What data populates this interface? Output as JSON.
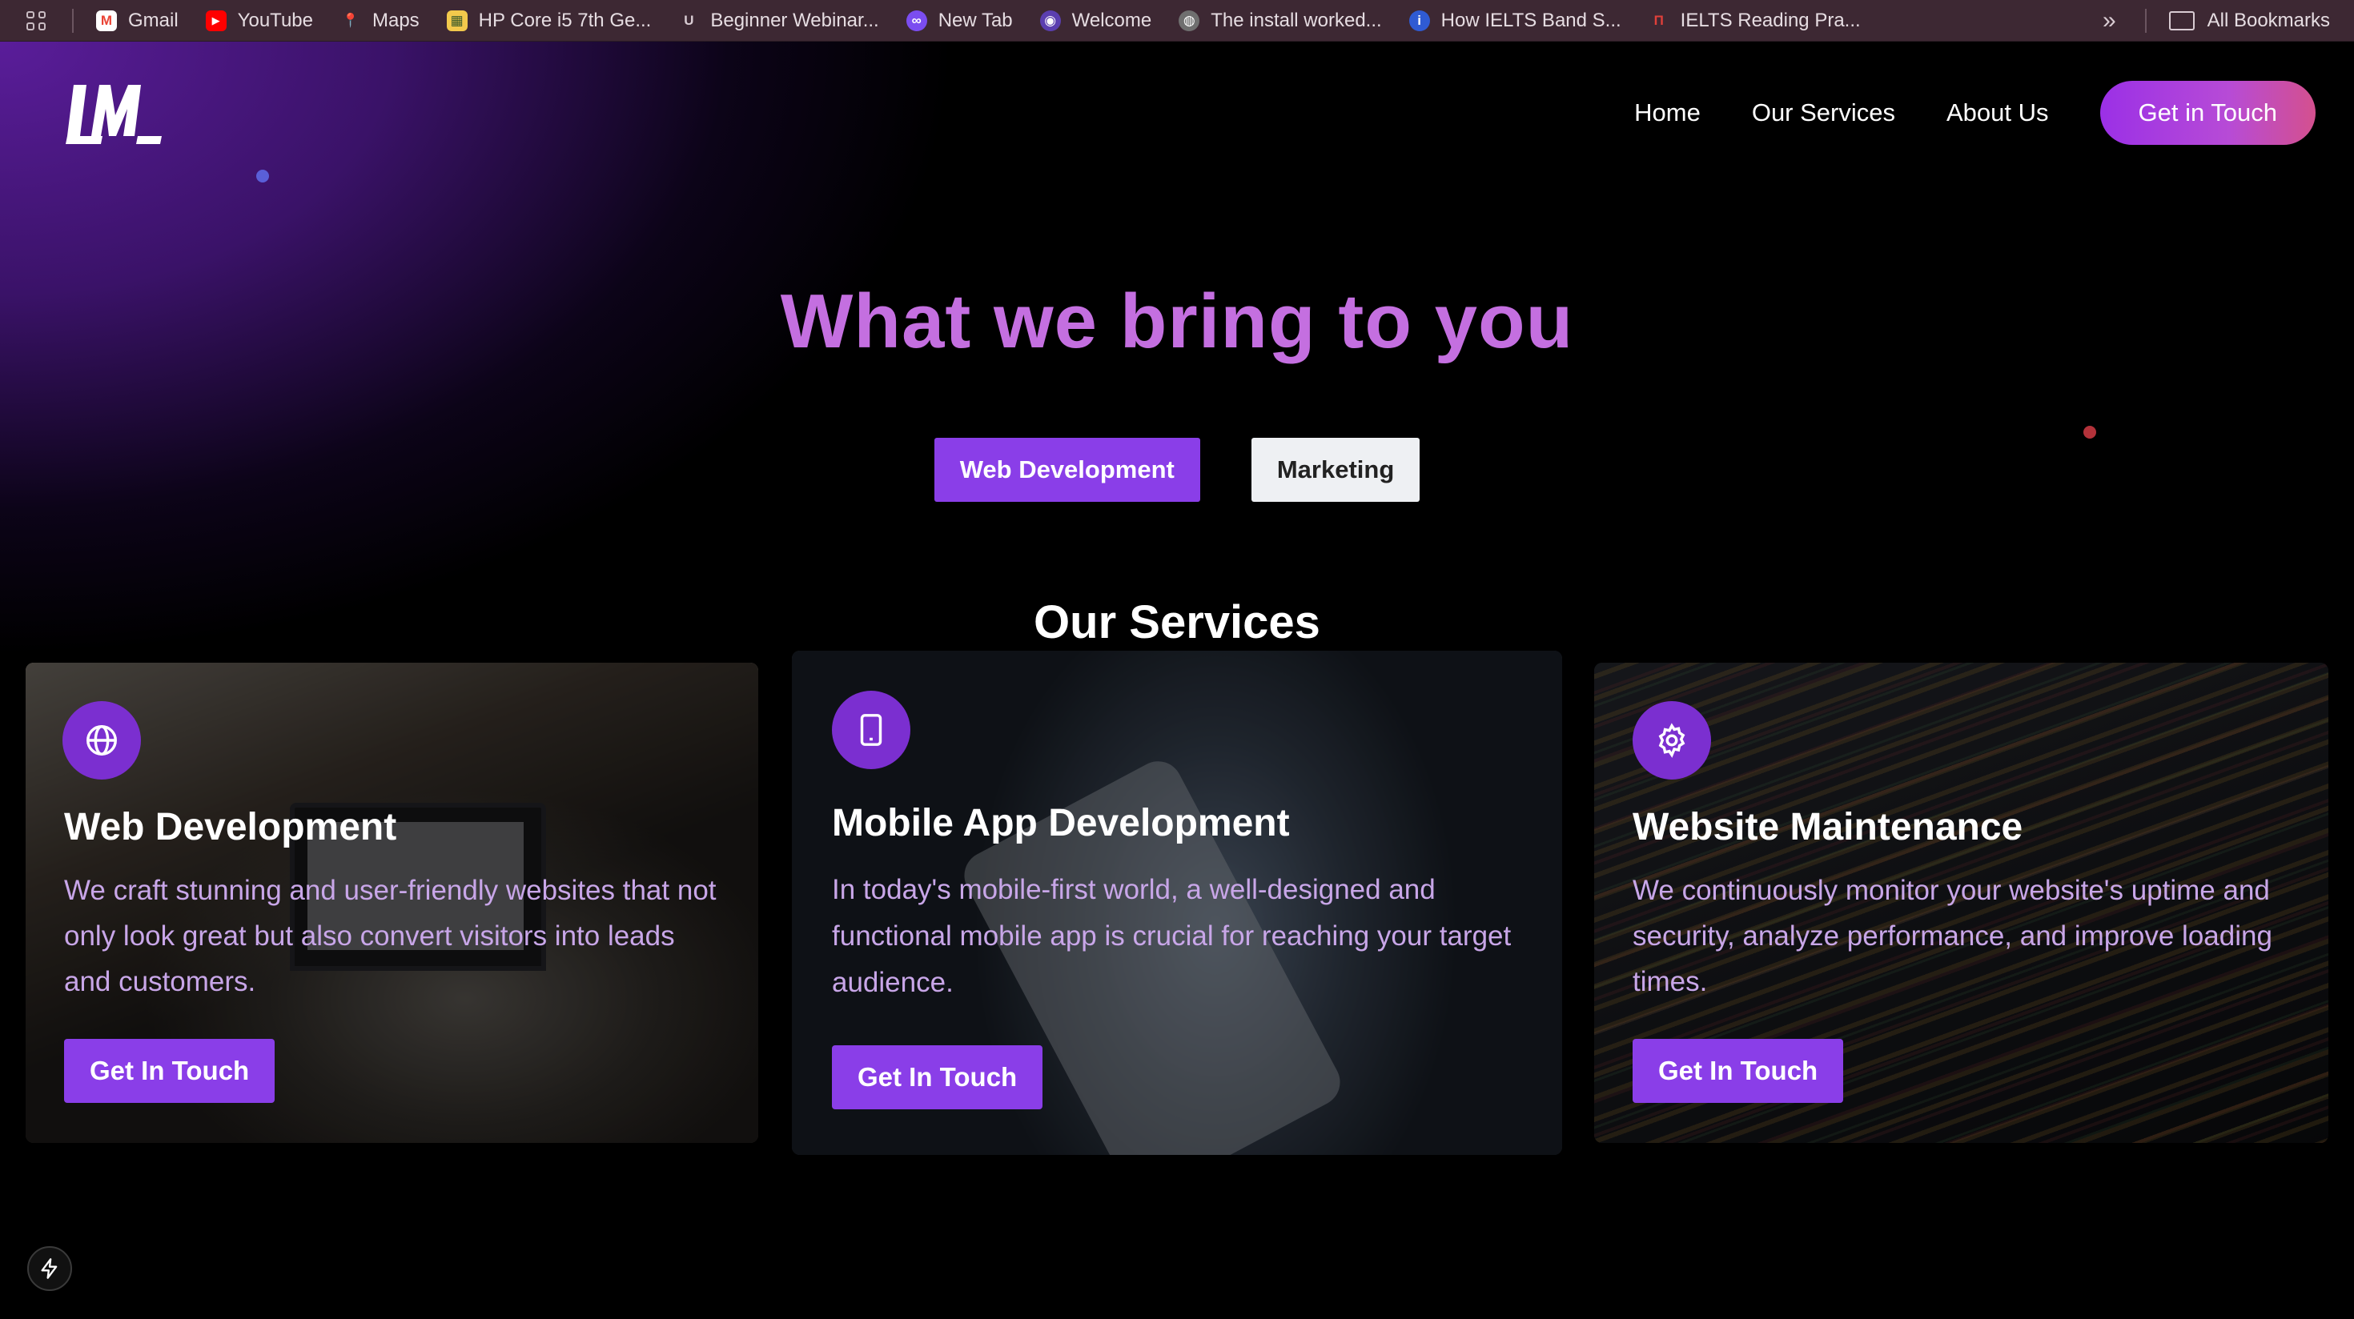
{
  "bookmarks": {
    "items": [
      {
        "label": "Gmail",
        "icon": "gmail-icon",
        "color": "#ea4335",
        "glyph": "M"
      },
      {
        "label": "YouTube",
        "icon": "youtube-icon",
        "color": "#ff0000",
        "glyph": "▶"
      },
      {
        "label": "Maps",
        "icon": "maps-icon",
        "color": "#34a853",
        "glyph": "⬤"
      },
      {
        "label": "HP Core i5 7th Ge...",
        "icon": "hp-icon",
        "color": "#f2c94c",
        "glyph": "▦"
      },
      {
        "label": "Beginner Webinar...",
        "icon": "webinar-icon",
        "color": "#3d2833",
        "glyph": "U"
      },
      {
        "label": "New Tab",
        "icon": "newtab-icon",
        "color": "#7b4df0",
        "glyph": "∞"
      },
      {
        "label": "Welcome",
        "icon": "welcome-icon",
        "color": "#5b3fb0",
        "glyph": "◉"
      },
      {
        "label": "The install worked...",
        "icon": "globe-icon",
        "color": "#6f6f6f",
        "glyph": "◍"
      },
      {
        "label": "How IELTS Band S...",
        "icon": "ielts-icon",
        "color": "#2f5bd3",
        "glyph": "i"
      },
      {
        "label": "IELTS Reading Pra...",
        "icon": "ielts-reading-icon",
        "color": "#c0392b",
        "glyph": "П"
      }
    ],
    "overflow": "»",
    "all_bookmarks": "All Bookmarks"
  },
  "nav": {
    "links": [
      "Home",
      "Our Services",
      "About Us"
    ],
    "cta": "Get in Touch"
  },
  "hero": {
    "title": "What we bring to you"
  },
  "tabs": {
    "active": "Web Development",
    "inactive": "Marketing"
  },
  "section_title": "Our Services",
  "cards": [
    {
      "title": "Web Development",
      "description": "We craft stunning and user-friendly websites that not only look great but also convert visitors into leads and customers.",
      "button": "Get In Touch",
      "icon": "globe-icon"
    },
    {
      "title": "Mobile App Development",
      "description": "In today's mobile-first world, a well-designed and functional mobile app is crucial for reaching your target audience.",
      "button": "Get In Touch",
      "icon": "phone-icon"
    },
    {
      "title": "Website Maintenance",
      "description": "We continuously monitor your website's uptime and security, analyze performance, and improve loading times.",
      "button": "Get In Touch",
      "icon": "gear-icon"
    }
  ],
  "colors": {
    "accent": "#8a3ee8",
    "title": "#c46fe0",
    "card_text": "#c8a6e8"
  }
}
